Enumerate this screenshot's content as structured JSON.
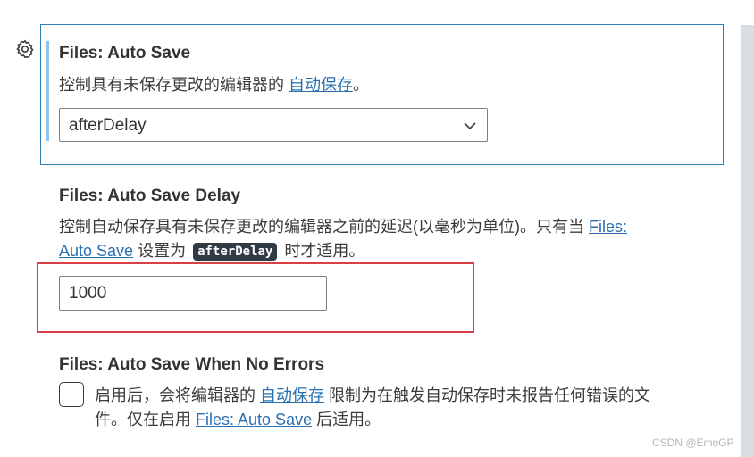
{
  "colors": {
    "focus_border": "#2f7fb5",
    "modified_indicator": "#93c2ea",
    "link": "#2a6fb0",
    "highlight": "#d94045",
    "code_chip_bg": "#2f3a45"
  },
  "icons": {
    "settings_gear": "gear-icon",
    "dropdown": "chevron-down-icon"
  },
  "settings": {
    "auto_save": {
      "title": "Files: Auto Save",
      "desc_prefix": "控制具有未保存更改的编辑器的 ",
      "desc_link": "自动保存",
      "desc_suffix": "。",
      "selected_value": "afterDelay"
    },
    "auto_save_delay": {
      "title": "Files: Auto Save Delay",
      "desc_line1_prefix": "控制自动保存具有未保存更改的编辑器之前的延迟(以毫秒为单位)。只有当 ",
      "desc_link_part1": "Files:",
      "desc_link_part2": "Auto Save",
      "desc_line2_middle": " 设置为 ",
      "desc_code": "afterDelay",
      "desc_line2_suffix": " 时才适用。",
      "value": "1000"
    },
    "auto_save_when_no_errors": {
      "title": "Files: Auto Save When No Errors",
      "desc_line1_prefix": "启用后，会将编辑器的 ",
      "desc_link": "自动保存",
      "desc_line1_suffix": " 限制为在触发自动保存时未报告任何错误的文",
      "desc_line2_prefix": "件。仅在启用 ",
      "desc_line2_link": "Files: Auto Save",
      "desc_line2_suffix": " 后适用。",
      "checked": false
    }
  },
  "watermark": "CSDN @EmoGP"
}
